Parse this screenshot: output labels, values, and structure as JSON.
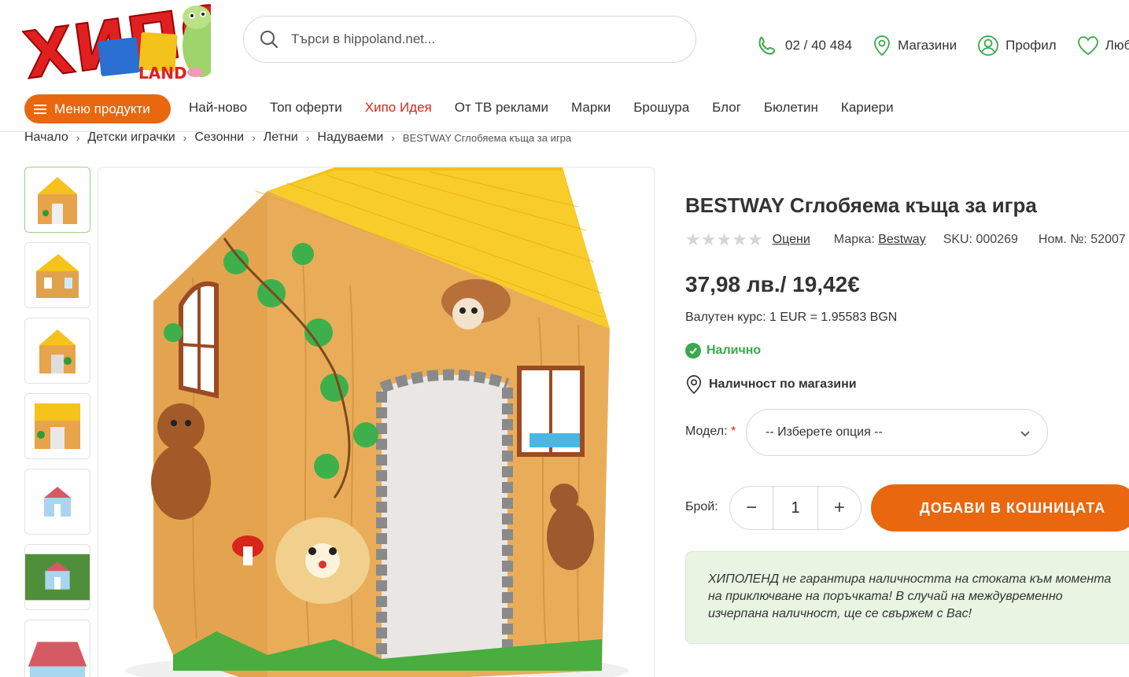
{
  "logo": {
    "text": "ХИПО",
    "sub": "LAND"
  },
  "search": {
    "placeholder": "Търси в hippoland.net..."
  },
  "header_links": {
    "phone": "02 / 40 484",
    "stores": "Магазини",
    "profile": "Профил",
    "favorites": "Любими"
  },
  "nav": {
    "menu_button": "Меню продукти",
    "items": [
      "Най-ново",
      "Топ оферти",
      "Хипо Идея",
      "От ТВ реклами",
      "Марки",
      "Брошура",
      "Блог",
      "Бюлетин",
      "Кариери"
    ]
  },
  "breadcrumb": [
    "Начало",
    "Детски играчки",
    "Сезонни",
    "Летни",
    "Надуваеми",
    "BESTWAY Сглобяема къща за игра"
  ],
  "product": {
    "title": "BESTWAY Сглобяема къща за игра",
    "rate_link": "Оцени",
    "brand_label": "Марка:",
    "brand": "Bestway",
    "sku": "SKU: 000269",
    "catalog_no": "Ном. №: 52007",
    "price": "37,98 лв./ 19,42€",
    "exchange_rate": "Валутен курс: 1 EUR = 1.95583 BGN",
    "stock": "Налично",
    "store_availability": "Наличност по магазини",
    "model_label": "Модел:",
    "model_required": "*",
    "model_select": "-- Изберете опция --",
    "qty_label": "Брой:",
    "qty_value": "1",
    "qty_minus": "−",
    "qty_plus": "+",
    "add_to_cart": "ДОБАВИ В КОШНИЦАТА",
    "notice": "ХИПОЛЕНД не гарантира наличността на стоката към момента на приключване на поръчката! В случай на междувременно изчерпана наличност, ще се свържем с Вас!"
  },
  "colors": {
    "accent": "#e8670f",
    "in_stock": "#3aa84b",
    "notice_bg": "#e8f5e3",
    "highlight_nav": "#d8261a"
  }
}
